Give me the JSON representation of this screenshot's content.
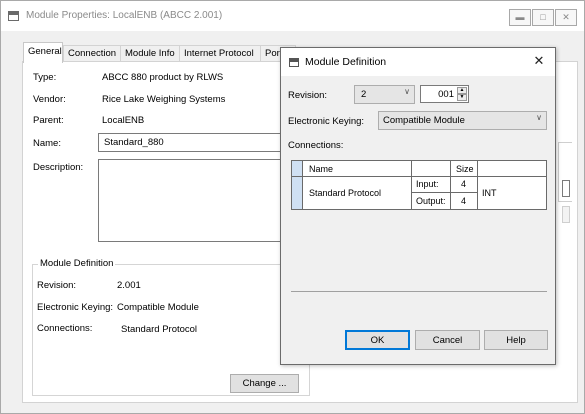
{
  "window": {
    "title": "Module Properties: LocalENB (ABCC 2.001)",
    "caption_buttons": [
      "minimize",
      "maximize",
      "close"
    ]
  },
  "tabs": [
    {
      "label": "General",
      "active": true
    },
    {
      "label": "Connection",
      "active": false
    },
    {
      "label": "Module Info",
      "active": false
    },
    {
      "label": "Internet Protocol",
      "active": false
    },
    {
      "label": "Port C",
      "active": false
    }
  ],
  "general": {
    "type_label": "Type:",
    "type_value": "ABCC 880 product by RLWS",
    "vendor_label": "Vendor:",
    "vendor_value": "Rice Lake Weighing Systems",
    "parent_label": "Parent:",
    "parent_value": "LocalENB",
    "name_label": "Name:",
    "name_value": "Standard_880",
    "description_label": "Description:",
    "description_value": ""
  },
  "module_definition": {
    "group_title": "Module Definition",
    "revision_label": "Revision:",
    "revision_value": "2.001",
    "keying_label": "Electronic Keying:",
    "keying_value": "Compatible Module",
    "connections_label": "Connections:",
    "connections_value": "Standard Protocol",
    "change_button": "Change ..."
  },
  "dialog": {
    "title": "Module Definition",
    "revision_label": "Revision:",
    "revision_major": "2",
    "revision_minor": "001",
    "keying_label": "Electronic Keying:",
    "keying_value": "Compatible Module",
    "connections_label": "Connections:",
    "table": {
      "headers": {
        "name": "Name",
        "size": "Size"
      },
      "row": {
        "name": "Standard Protocol",
        "input_label": "Input:",
        "input_size": "4",
        "output_label": "Output:",
        "output_size": "4",
        "type": "INT"
      }
    },
    "ok_button": "OK",
    "cancel_button": "Cancel",
    "help_button": "Help"
  }
}
